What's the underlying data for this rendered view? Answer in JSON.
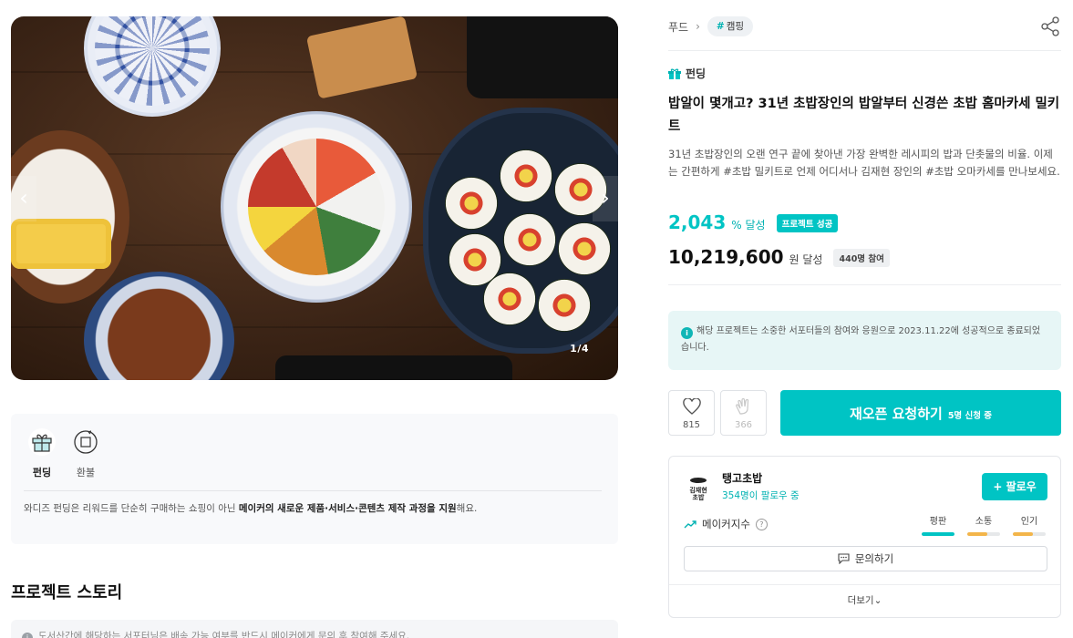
{
  "breadcrumb": {
    "category": "푸드",
    "tag": "캠핑",
    "tag_prefix": "#"
  },
  "hero": {
    "counter": "1/4",
    "prev_glyph": "‹",
    "next_glyph": "›"
  },
  "info": {
    "tabs": [
      {
        "label": "펀딩",
        "icon": "gift-icon",
        "active": true
      },
      {
        "label": "환불",
        "icon": "refund-icon",
        "active": false
      }
    ],
    "text_pre": "와디즈 펀딩은 리워드를 단순히 구매하는 쇼핑이 아닌 ",
    "text_bold": "메이커의 새로운 제품·서비스·콘텐츠 제작 과정을 지원",
    "text_post": "해요."
  },
  "story": {
    "title": "프로젝트 스토리",
    "notice": "도서산간에 해당하는 서포터님은 배송 가능 여부를 반드시 메이커에게 문의 후 참여해 주세요."
  },
  "project": {
    "type_label": "펀딩",
    "title": "밥알이 몇개고? 31년 초밥장인의 밥알부터 신경쓴 초밥 홈마카세 밀키트",
    "description": "31년 초밥장인의 오랜 연구 끝에 찾아낸 가장 완벽한 레시피의 밥과 단촛물의 비율. 이제는 간편하게 #초밥 밀키트로 언제 어디서나 김재현 장인의 #초밥 오마카세를 만나보세요.",
    "rate": "2,043",
    "rate_unit": "% 달성",
    "success_badge": "프로젝트 성공",
    "amount": "10,219,600",
    "amount_unit": "원 달성",
    "participants": "440명 참여",
    "notice": "해당 프로젝트는 소중한 서포터들의 참여와 응원으로 2023.11.22에 성공적으로 종료되었습니다.",
    "notice_icon": "i"
  },
  "actions": {
    "like_count": "815",
    "cheer_count": "366",
    "reopen_label": "재오픈 요청하기",
    "reopen_sub": "5명 신청 중"
  },
  "maker": {
    "logo_text": "김재현\n초밥",
    "name": "탱고초밥",
    "followers": "354명이 팔로우 중",
    "follow_label": "팔로우",
    "follow_icon": "+",
    "index_label": "메이커지수",
    "metrics": [
      {
        "label": "평판",
        "value": 1.0,
        "color": "#00c4c4"
      },
      {
        "label": "소통",
        "value": 0.6,
        "color": "#f3b54a"
      },
      {
        "label": "인기",
        "value": 0.6,
        "color": "#f3b54a"
      }
    ],
    "inquiry_label": "문의하기",
    "more_label": "더보기"
  },
  "colors": {
    "accent": "#00c4c4",
    "accent_dark": "#00b2b2",
    "alert_bg": "#e7f6f6"
  }
}
